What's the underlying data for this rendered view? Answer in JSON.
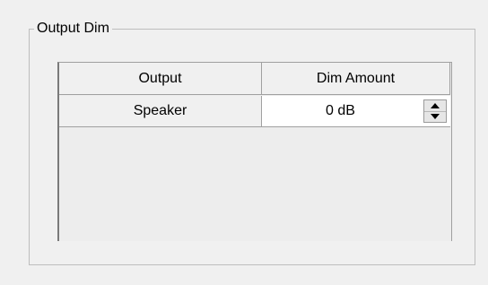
{
  "group": {
    "title": "Output Dim"
  },
  "grid": {
    "columns": [
      "Output",
      "Dim Amount"
    ],
    "rows": [
      {
        "output": "Speaker",
        "dim_amount": "0 dB"
      }
    ]
  },
  "icons": {
    "spin_up": "triangle-up-icon",
    "spin_down": "triangle-down-icon"
  }
}
